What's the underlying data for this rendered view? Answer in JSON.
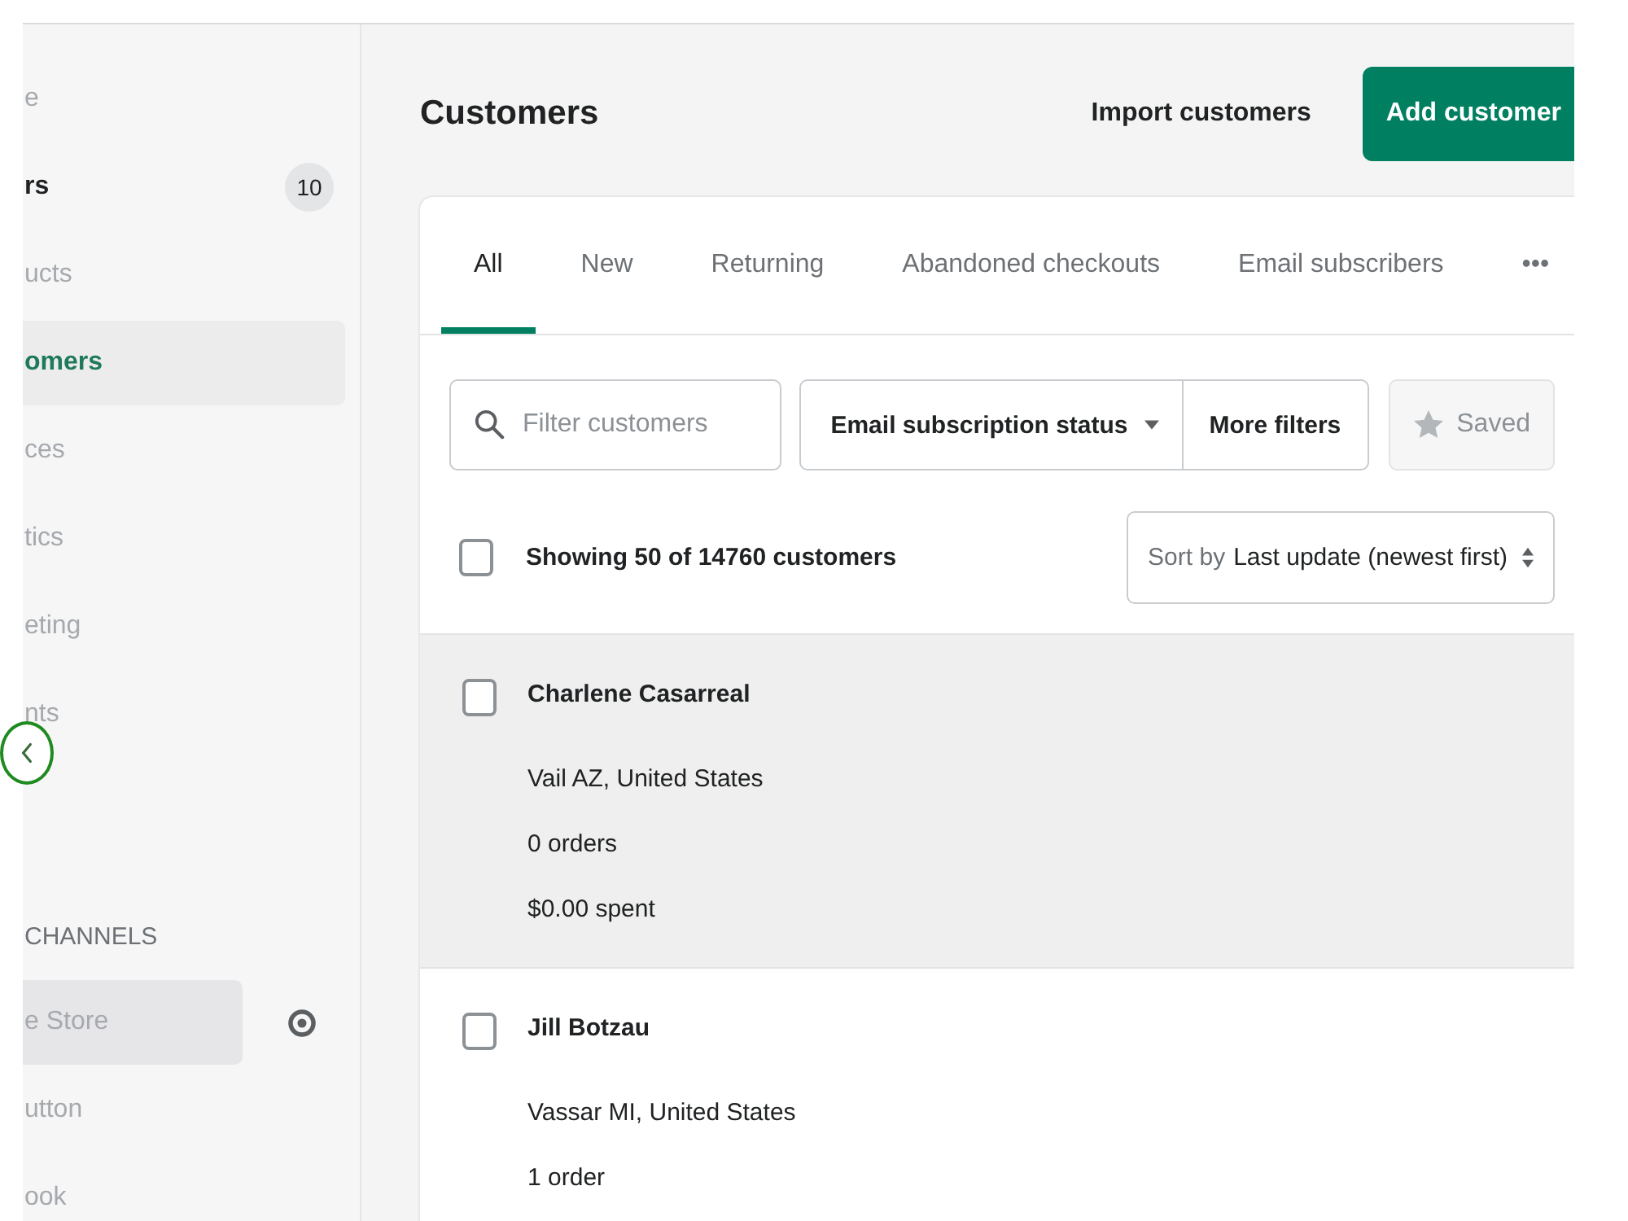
{
  "sidebar": {
    "items": [
      {
        "label": "e",
        "selected": false,
        "emphasized": false
      },
      {
        "label": "rs",
        "selected": false,
        "emphasized": true,
        "badge": "10"
      },
      {
        "label": "ucts",
        "selected": false,
        "emphasized": false
      },
      {
        "label": "omers",
        "selected": true,
        "emphasized": false
      },
      {
        "label": "ces",
        "selected": false,
        "emphasized": false
      },
      {
        "label": "tics",
        "selected": false,
        "emphasized": false
      },
      {
        "label": "eting",
        "selected": false,
        "emphasized": false
      },
      {
        "label": "nts",
        "selected": false,
        "emphasized": false
      }
    ],
    "channels_heading": "CHANNELS",
    "channels": [
      {
        "label": "e Store",
        "highlighted": true,
        "visible_icon": true
      },
      {
        "label": "utton",
        "highlighted": false,
        "visible_icon": false
      },
      {
        "label": "ook",
        "highlighted": false,
        "visible_icon": false
      }
    ]
  },
  "page": {
    "title": "Customers",
    "import_button": "Import customers",
    "add_button": "Add customer"
  },
  "tabs": [
    {
      "label": "All",
      "selected": true
    },
    {
      "label": "New",
      "selected": false
    },
    {
      "label": "Returning",
      "selected": false
    },
    {
      "label": "Abandoned checkouts",
      "selected": false
    },
    {
      "label": "Email subscribers",
      "selected": false
    },
    {
      "label": "•••",
      "selected": false
    }
  ],
  "filters": {
    "search": {
      "placeholder": "Filter customers"
    },
    "subscription_filter": "Email subscription status",
    "more_filters": "More filters",
    "saved": {
      "label": "Saved",
      "disabled": true
    }
  },
  "list_header": {
    "summary": "Showing 50 of 14760 customers",
    "select_all_checked": false,
    "sort_prefix": "Sort by",
    "sort_value": "Last update (newest first)"
  },
  "customers": [
    {
      "name": "Charlene Casarreal",
      "location": "Vail AZ, United States",
      "orders": "0 orders",
      "spent": "$0.00 spent",
      "checked": false,
      "highlighted": true
    },
    {
      "name": "Jill Botzau",
      "location": "Vassar MI, United States",
      "orders": "1 order",
      "checked": false,
      "highlighted": false
    }
  ]
}
